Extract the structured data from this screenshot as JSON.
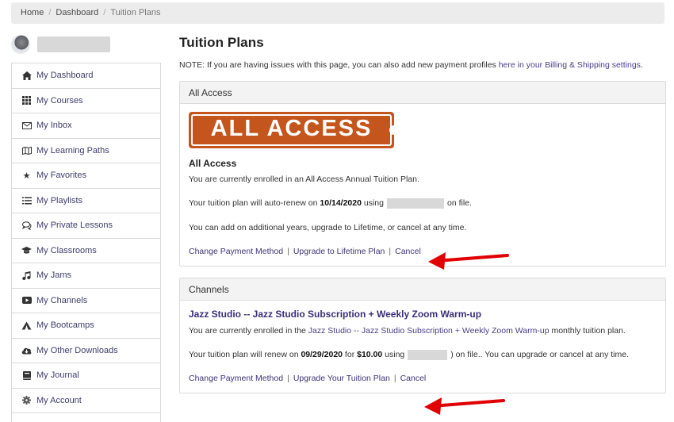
{
  "breadcrumb": {
    "home": "Home",
    "dashboard": "Dashboard",
    "current": "Tuition Plans"
  },
  "sidebar": {
    "items": [
      {
        "label": "My Dashboard",
        "icon": "home-icon"
      },
      {
        "label": "My Courses",
        "icon": "grid-icon"
      },
      {
        "label": "My Inbox",
        "icon": "envelope-icon"
      },
      {
        "label": "My Learning Paths",
        "icon": "map-icon"
      },
      {
        "label": "My Favorites",
        "icon": "star-icon"
      },
      {
        "label": "My Playlists",
        "icon": "list-icon"
      },
      {
        "label": "My Private Lessons",
        "icon": "chat-icon"
      },
      {
        "label": "My Classrooms",
        "icon": "graduation-cap-icon"
      },
      {
        "label": "My Jams",
        "icon": "music-note-icon"
      },
      {
        "label": "My Channels",
        "icon": "video-play-icon"
      },
      {
        "label": "My Bootcamps",
        "icon": "tent-icon"
      },
      {
        "label": "My Other Downloads",
        "icon": "cloud-download-icon"
      },
      {
        "label": "My Journal",
        "icon": "book-icon"
      },
      {
        "label": "My Account",
        "icon": "gear-icon"
      }
    ]
  },
  "main": {
    "title": "Tuition Plans",
    "note_prefix": "NOTE: If you are having issues with this page, you can also add new payment profiles ",
    "note_link": "here in your Billing & Shipping settings",
    "note_suffix": "."
  },
  "all_access": {
    "header": "All Access",
    "logo_text": "ALL ACCESS",
    "title": "All Access",
    "enrolled": "You are currently enrolled in an All Access Annual Tuition Plan.",
    "renew_prefix": "Your tuition plan will auto-renew on ",
    "renew_date": "10/14/2020",
    "renew_using": " using",
    "renew_suffix": "on file.",
    "info": "You can add on additional years, upgrade to Lifetime, or cancel at any time.",
    "action_change": "Change Payment Method",
    "action_upgrade": "Upgrade to Lifetime Plan",
    "action_cancel": "Cancel"
  },
  "channels": {
    "header": "Channels",
    "course_title": "Jazz Studio -- Jazz Studio Subscription + Weekly Zoom Warm-up",
    "enrolled_prefix": "You are currently enrolled in the ",
    "enrolled_link": "Jazz Studio -- Jazz Studio Subscription + Weekly Zoom Warm-up",
    "enrolled_suffix": " monthly tuition plan.",
    "renew_prefix": "Your tuition plan will renew on ",
    "renew_date": "09/29/2020",
    "renew_for": " for ",
    "renew_amount": "$10.00",
    "renew_using": " using",
    "renew_suffix": ") on file.. You can upgrade or cancel at any time.",
    "action_change": "Change Payment Method",
    "action_upgrade": "Upgrade Your Tuition Plan",
    "action_cancel": "Cancel"
  },
  "colors": {
    "accent": "#c4551d",
    "link": "#4b3e8a",
    "arrow": "#e00000"
  }
}
